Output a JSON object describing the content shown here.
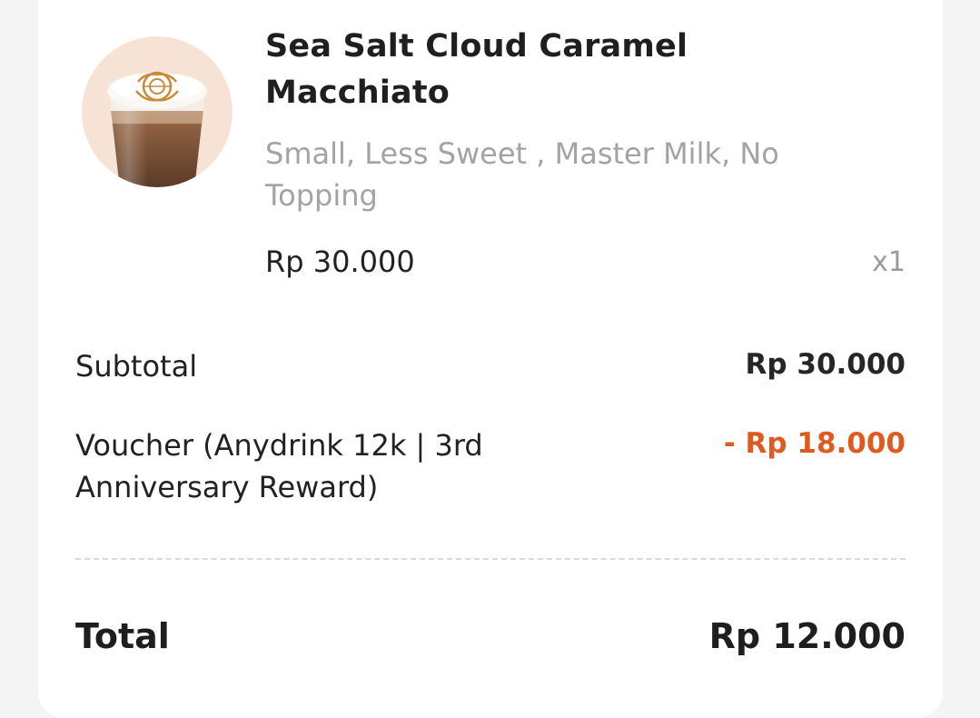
{
  "item": {
    "name": "Sea Salt Cloud Caramel Macchiato",
    "options": "Small, Less Sweet , Master Milk, No Topping",
    "price": "Rp 30.000",
    "quantity": "x1",
    "image_icon": "caramel-macchiato-cup-icon"
  },
  "summary": {
    "subtotal_label": "Subtotal",
    "subtotal_value": "Rp 30.000",
    "voucher_label": "Voucher (Anydrink 12k | 3rd Anniversary Reward)",
    "voucher_value": "- Rp 18.000",
    "total_label": "Total",
    "total_value": "Rp 12.000"
  },
  "colors": {
    "discount": "#e05a1f",
    "muted_text": "#a3a3a3",
    "thumbnail_bg": "#f6e3d5"
  }
}
